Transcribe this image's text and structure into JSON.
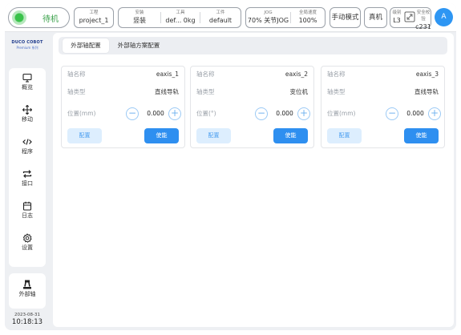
{
  "topbar": {
    "status": "待机",
    "project": {
      "label": "工程",
      "value": "project_1"
    },
    "install": {
      "label": "安装",
      "value": "竖装"
    },
    "tool": {
      "label": "工具",
      "value": "def... 0kg"
    },
    "work": {
      "label": "工件",
      "value": "default"
    },
    "jog": {
      "label": "JOG",
      "value": "70%  关节JOG"
    },
    "global_speed": {
      "label": "全局速度",
      "value": "100%"
    },
    "manual_mode": "手动模式",
    "real_robot": "真机",
    "level": {
      "label": "级别",
      "value": "L3"
    },
    "safety_check": {
      "label": "安全校验",
      "value": "c231"
    },
    "avatar": "A"
  },
  "logo": {
    "main": "DUCO COBOT",
    "sub": "Premium 系列"
  },
  "sidebar": {
    "items": [
      {
        "label": "概览",
        "icon": "monitor-icon"
      },
      {
        "label": "移动",
        "icon": "move-arrows-icon"
      },
      {
        "label": "程序",
        "icon": "code-icon"
      },
      {
        "label": "接口",
        "icon": "swap-arrows-icon"
      },
      {
        "label": "日志",
        "icon": "calendar-icon"
      },
      {
        "label": "设置",
        "icon": "gear-icon"
      }
    ],
    "external_axis": {
      "label": "外部轴",
      "icon": "robot-icon"
    }
  },
  "clock": {
    "date": "2023-08-31",
    "time": "10:18:13"
  },
  "tabs": [
    {
      "label": "外部轴配置",
      "active": true
    },
    {
      "label": "外部轴方案配置",
      "active": false
    }
  ],
  "axes": [
    {
      "name_label": "轴名称",
      "name": "eaxis_1",
      "type_label": "轴类型",
      "type": "直线导轨",
      "pos_label": "位置(mm)",
      "pos": "0.000",
      "config": "配置",
      "enable": "使能"
    },
    {
      "name_label": "轴名称",
      "name": "eaxis_2",
      "type_label": "轴类型",
      "type": "变位机",
      "pos_label": "位置(°)",
      "pos": "0.000",
      "config": "配置",
      "enable": "使能"
    },
    {
      "name_label": "轴名称",
      "name": "eaxis_3",
      "type_label": "轴类型",
      "type": "直线导轨",
      "pos_label": "位置(mm)",
      "pos": "0.000",
      "config": "配置",
      "enable": "使能"
    }
  ],
  "colors": {
    "accent": "#2e8ff0",
    "status_green": "#39c24a",
    "panel_bg": "#eef0f3"
  }
}
